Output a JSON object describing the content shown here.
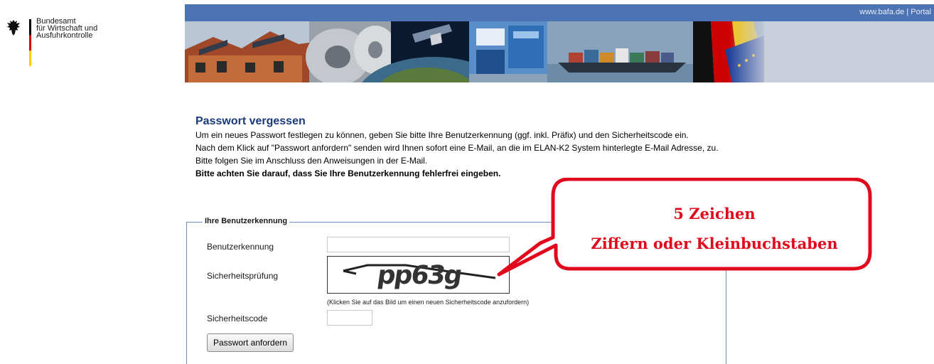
{
  "logo": {
    "line1": "Bundesamt",
    "line2": "für Wirtschaft und",
    "line3": "Ausfuhrkontrolle",
    "icon": "federal-eagle-icon"
  },
  "header": {
    "link_bafa": "www.bafa.de",
    "separator": " | ",
    "link_portal": "Portal",
    "bar_color": "#4c73b3"
  },
  "main": {
    "title": "Passwort vergessen",
    "para1": "Um ein neues Passwort festlegen zu können, geben Sie bitte Ihre Benutzerkennung (ggf. inkl. Präfix) und den Sicherheitscode ein.",
    "para2": "Nach dem Klick auf \"Passwort anfordern\" senden wird Ihnen sofort eine E-Mail, an die im ELAN-K2 System hinterlegte E-Mail Adresse, zu.",
    "para3": "Bitte folgen Sie im Anschluss den Anweisungen in der E-Mail.",
    "para4": "Bitte achten Sie darauf, dass Sie Ihre Benutzerkennung fehlerfrei eingeben."
  },
  "form": {
    "legend": "Ihre Benutzerkennung",
    "user_label": "Benutzerkennung",
    "user_value": "",
    "captcha_label": "Sicherheitsprüfung",
    "captcha_text": "pp63g",
    "captcha_hint": "(Klicken Sie auf das Bild um einen neuen Sicherheitscode anzufordern)",
    "code_label": "Sicherheitscode",
    "code_value": "",
    "submit_label": "Passwort anfordern"
  },
  "annotation": {
    "line1": "5 Zeichen",
    "line2": "Ziffern oder Kleinbuchstaben",
    "color": "#e10a1c"
  }
}
